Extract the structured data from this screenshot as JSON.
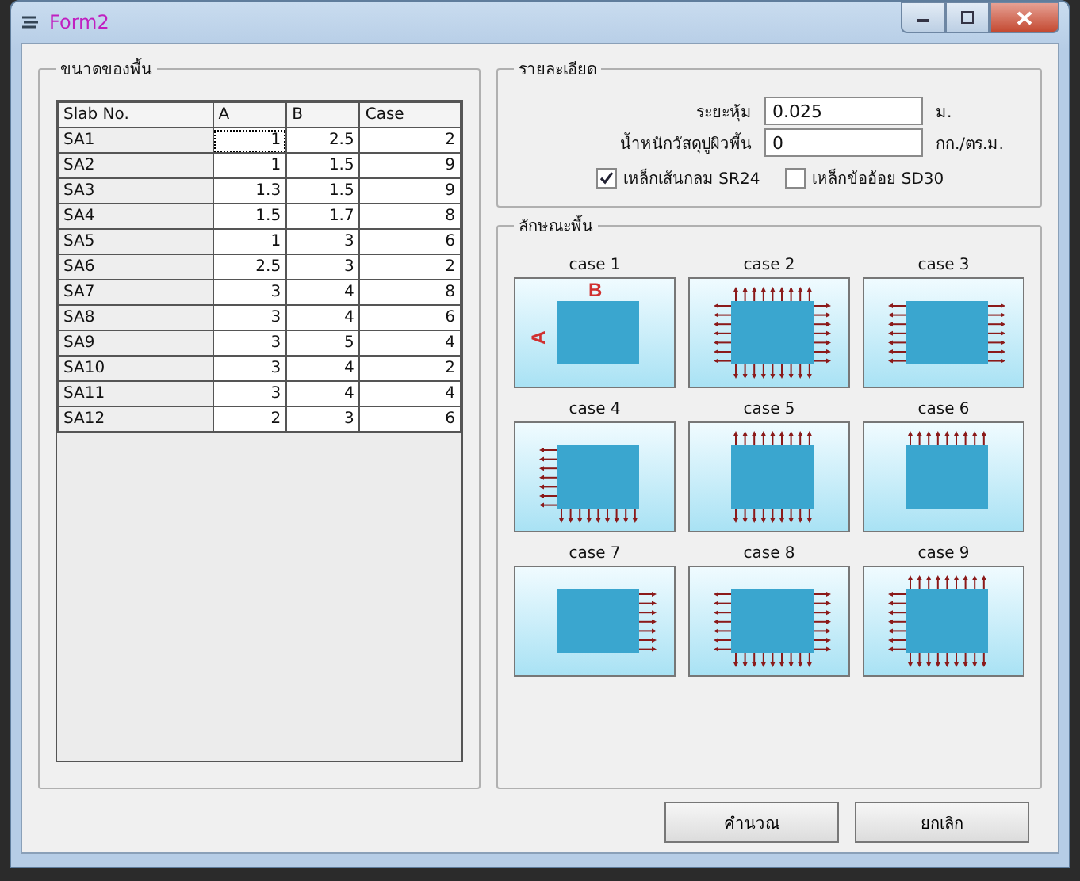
{
  "window": {
    "title": "Form2"
  },
  "slab_group": {
    "title": "ขนาดของพื้น"
  },
  "table": {
    "columns": [
      "Slab No.",
      "A",
      "B",
      "Case"
    ],
    "rows": [
      {
        "cells": [
          "SA1",
          "1",
          "2.5",
          "2"
        ],
        "selected": true
      },
      {
        "cells": [
          "SA2",
          "1",
          "1.5",
          "9"
        ],
        "selected": false
      },
      {
        "cells": [
          "SA3",
          "1.3",
          "1.5",
          "9"
        ],
        "selected": false
      },
      {
        "cells": [
          "SA4",
          "1.5",
          "1.7",
          "8"
        ],
        "selected": false
      },
      {
        "cells": [
          "SA5",
          "1",
          "3",
          "6"
        ],
        "selected": false
      },
      {
        "cells": [
          "SA6",
          "2.5",
          "3",
          "2"
        ],
        "selected": false
      },
      {
        "cells": [
          "SA7",
          "3",
          "4",
          "8"
        ],
        "selected": false
      },
      {
        "cells": [
          "SA8",
          "3",
          "4",
          "6"
        ],
        "selected": false
      },
      {
        "cells": [
          "SA9",
          "3",
          "5",
          "4"
        ],
        "selected": false
      },
      {
        "cells": [
          "SA10",
          "3",
          "4",
          "2"
        ],
        "selected": false
      },
      {
        "cells": [
          "SA11",
          "3",
          "4",
          "4"
        ],
        "selected": false
      },
      {
        "cells": [
          "SA12",
          "2",
          "3",
          "6"
        ],
        "selected": false
      }
    ]
  },
  "details": {
    "title": "รายละเอียด",
    "fields": [
      {
        "label": "ระยะหุ้ม",
        "value": "0.025",
        "unit": "ม."
      },
      {
        "label": "น้ำหนักวัสดุปูผิวพื้น",
        "value": "0",
        "unit": "กก./ตร.ม."
      }
    ],
    "checkboxes": [
      {
        "label": "เหล็กเส้นกลม SR24",
        "checked": true
      },
      {
        "label": "เหล็กข้ออ้อย SD30",
        "checked": false
      }
    ]
  },
  "cases_group": {
    "title": "ลักษณะพื้น",
    "cases": [
      {
        "label": "case 1",
        "arrows_top": false,
        "arrows_bottom": false,
        "arrows_left": false,
        "arrows_right": false,
        "side_labels": [
          "A",
          "B"
        ]
      },
      {
        "label": "case 2",
        "arrows_top": true,
        "arrows_bottom": true,
        "arrows_left": true,
        "arrows_right": true
      },
      {
        "label": "case 3",
        "arrows_top": false,
        "arrows_bottom": false,
        "arrows_left": true,
        "arrows_right": true
      },
      {
        "label": "case 4",
        "arrows_top": false,
        "arrows_bottom": true,
        "arrows_left": true,
        "arrows_right": false
      },
      {
        "label": "case 5",
        "arrows_top": true,
        "arrows_bottom": true,
        "arrows_left": false,
        "arrows_right": false
      },
      {
        "label": "case 6",
        "arrows_top": true,
        "arrows_bottom": false,
        "arrows_left": false,
        "arrows_right": false
      },
      {
        "label": "case 7",
        "arrows_top": false,
        "arrows_bottom": false,
        "arrows_left": false,
        "arrows_right": true
      },
      {
        "label": "case 8",
        "arrows_top": false,
        "arrows_bottom": true,
        "arrows_left": true,
        "arrows_right": true
      },
      {
        "label": "case 9",
        "arrows_top": true,
        "arrows_bottom": true,
        "arrows_left": true,
        "arrows_right": false
      }
    ]
  },
  "buttons": [
    "คำนวณ",
    "ยกเลิก"
  ]
}
